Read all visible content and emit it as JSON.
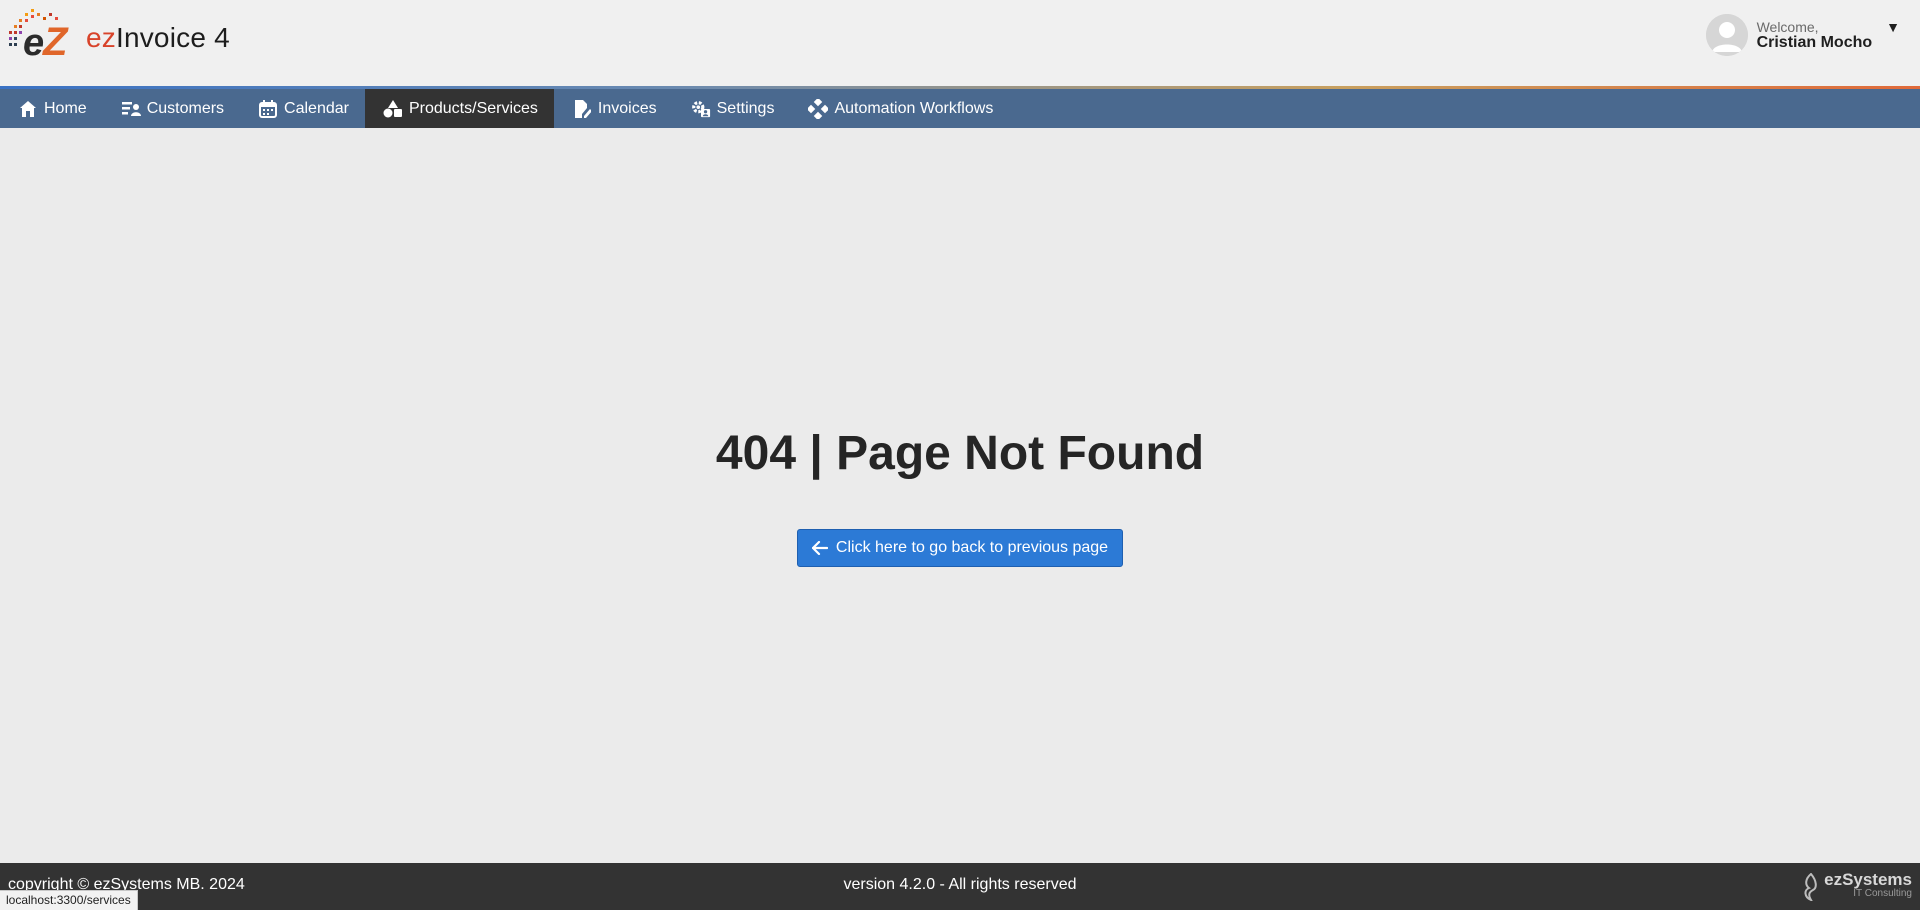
{
  "header": {
    "logo_prefix": "ez",
    "logo_suffix": "Invoice 4",
    "welcome": "Welcome,",
    "user_name": "Cristian Mocho",
    "caret": "▼"
  },
  "nav": {
    "items": [
      {
        "label": "Home",
        "icon": "home-icon"
      },
      {
        "label": "Customers",
        "icon": "customers-icon"
      },
      {
        "label": "Calendar",
        "icon": "calendar-icon"
      },
      {
        "label": "Products/Services",
        "icon": "shapes-icon"
      },
      {
        "label": "Invoices",
        "icon": "invoice-edit-icon"
      },
      {
        "label": "Settings",
        "icon": "settings-gear-icon"
      },
      {
        "label": "Automation Workflows",
        "icon": "workflow-icon"
      }
    ],
    "active": "Products/Services"
  },
  "main": {
    "title": "404 | Page Not Found",
    "back_button_label": "Click here to go back to previous page"
  },
  "footer": {
    "copyright": "copyright © ezSystems MB. 2024",
    "version": "version 4.2.0 - All rights reserved",
    "logo_main": "ezSystems",
    "logo_sub": "IT Consulting"
  },
  "status_bar": {
    "url": "localhost:3300/services"
  },
  "colors": {
    "nav_bg": "#4a698f",
    "nav_active": "#333333",
    "button": "#2c7ad6",
    "footer": "#333333",
    "brand_red": "#d8432a"
  }
}
